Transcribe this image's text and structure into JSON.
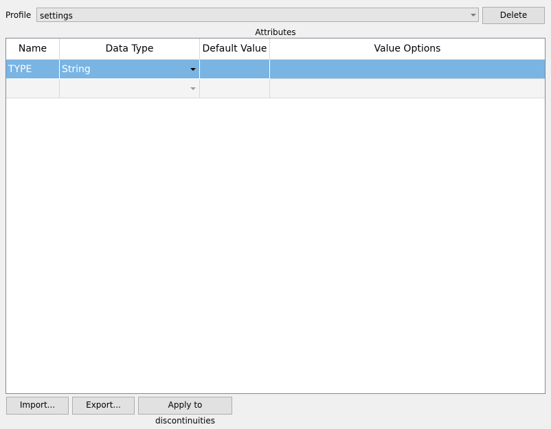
{
  "profile": {
    "label": "Profile",
    "value": "settings",
    "delete_label": "Delete"
  },
  "attributes": {
    "title": "Attributes",
    "columns": [
      "Name",
      "Data Type",
      "Default Value",
      "Value Options"
    ],
    "rows": [
      {
        "name": "TYPE",
        "data_type": "String",
        "default_value": "",
        "value_options": ""
      },
      {
        "name": "",
        "data_type": "",
        "default_value": "",
        "value_options": ""
      }
    ]
  },
  "buttons": {
    "import": "Import...",
    "export": "Export...",
    "apply": "Apply to discontinuities"
  },
  "colors": {
    "selection": "#79b4e3"
  }
}
